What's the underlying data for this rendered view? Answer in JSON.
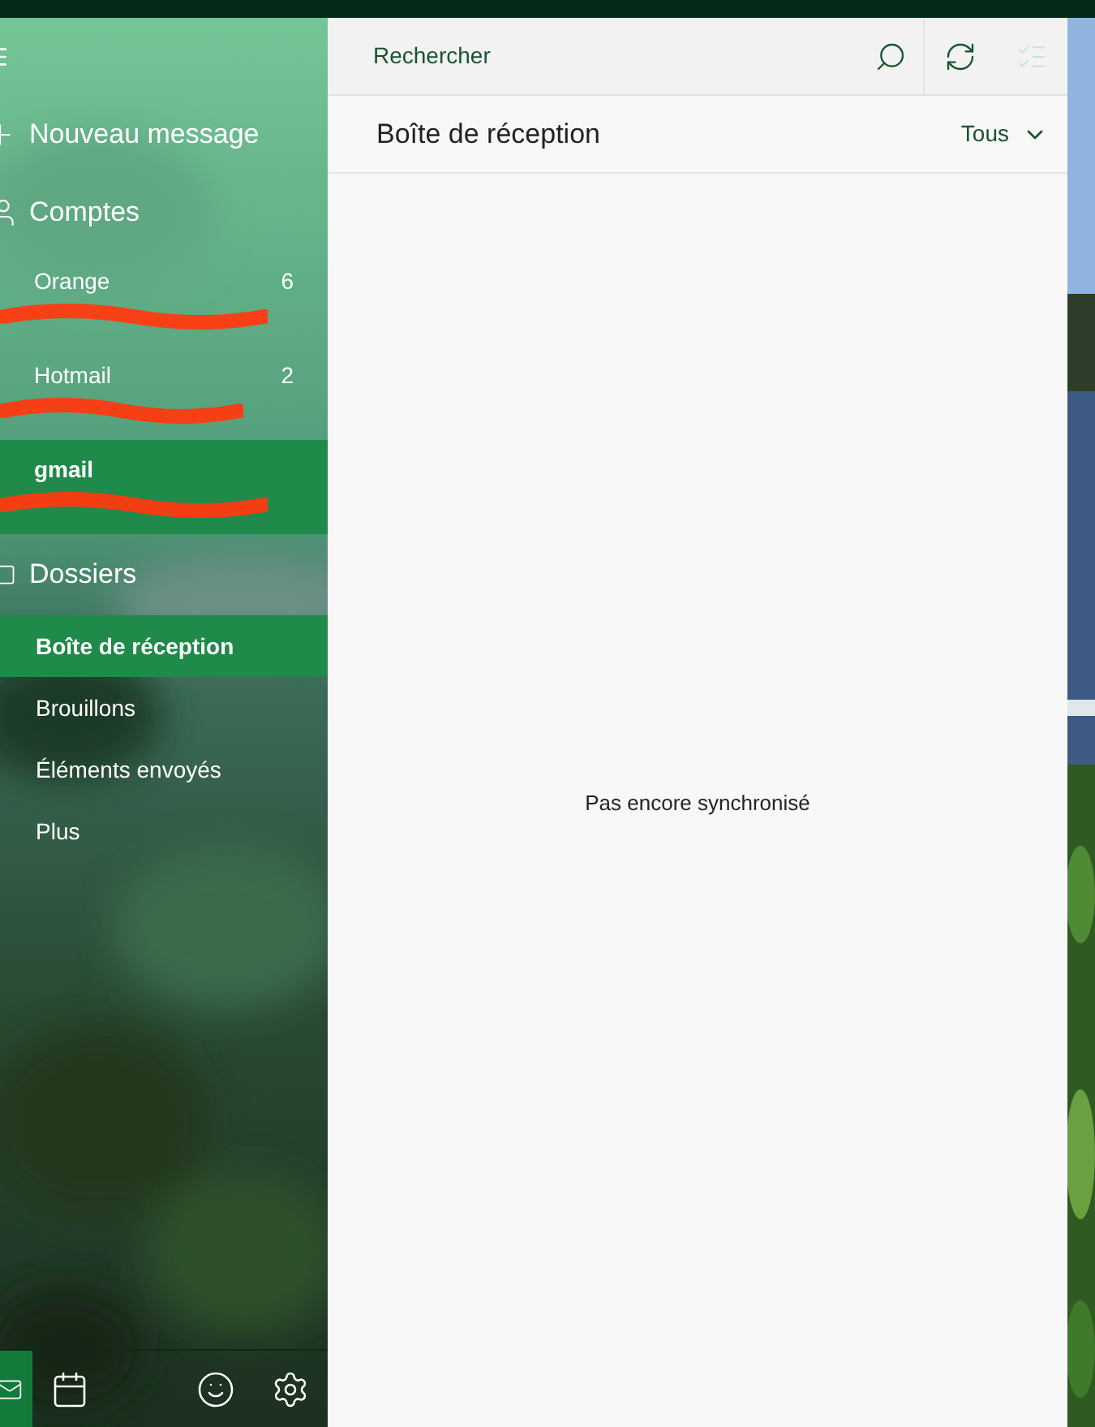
{
  "sidebar": {
    "new_message": "Nouveau message",
    "accounts_heading": "Comptes",
    "accounts": [
      {
        "name": "Orange",
        "count": "6",
        "selected": false
      },
      {
        "name": "Hotmail",
        "count": "2",
        "selected": false
      },
      {
        "name": "gmail",
        "selected": true
      }
    ],
    "folders_heading": "Dossiers",
    "folders": [
      {
        "label": "Boîte de réception",
        "selected": true
      },
      {
        "label": "Brouillons",
        "selected": false
      },
      {
        "label": "Éléments envoyés",
        "selected": false
      },
      {
        "label": "Plus",
        "selected": false
      }
    ],
    "bottom_bar": [
      {
        "kind": "mail",
        "selected": true
      },
      {
        "kind": "calendar",
        "selected": false
      },
      {
        "kind": "smiley",
        "selected": false
      },
      {
        "kind": "settings",
        "selected": false
      }
    ]
  },
  "search": {
    "placeholder": "Rechercher"
  },
  "inbox": {
    "title": "Boîte de réception",
    "filter": "Tous",
    "empty_message": "Pas encore synchronisé"
  }
}
